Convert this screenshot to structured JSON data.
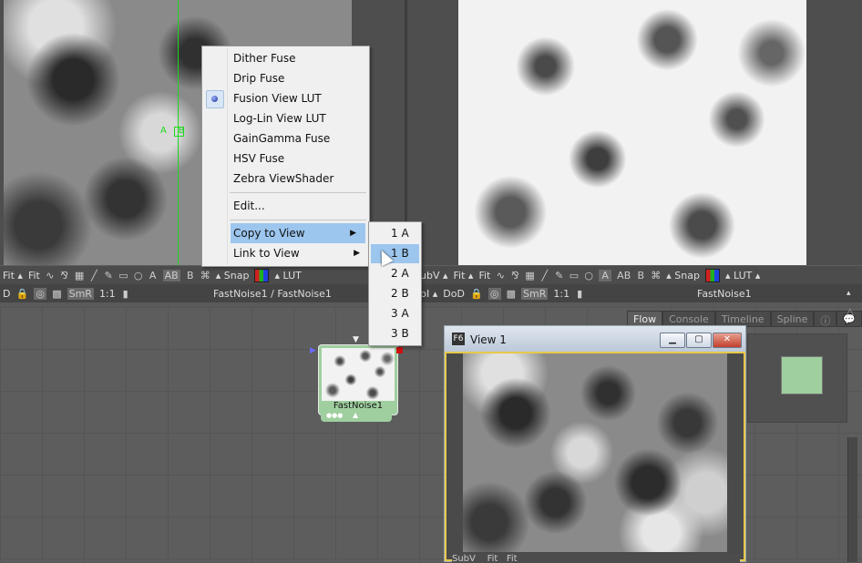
{
  "context_menu": {
    "items": [
      {
        "label": "Dither Fuse"
      },
      {
        "label": "Drip Fuse"
      },
      {
        "label": "Fusion View LUT",
        "selected": true
      },
      {
        "label": "Log-Lin View LUT"
      },
      {
        "label": "GainGamma Fuse"
      },
      {
        "label": "HSV Fuse"
      },
      {
        "label": "Zebra ViewShader"
      }
    ],
    "edit_label": "Edit...",
    "copy_to_view_label": "Copy to View",
    "link_to_view_label": "Link to View"
  },
  "submenu": {
    "items": [
      "1 A",
      "1 B",
      "2 A",
      "2 B",
      "3 A",
      "3 B"
    ],
    "highlighted": "1 B"
  },
  "left_viewer": {
    "guide_label": "A",
    "guide_label_b": "B",
    "toolbar": {
      "fit1": "Fit",
      "fit2": "Fit",
      "letter_a": "A",
      "letter_ab": "AB",
      "letter_b": "B",
      "snap": "Snap",
      "lut": "LUT",
      "d": "D",
      "smr": "SmR",
      "ratio": "1:1"
    },
    "view_name": "FastNoise1 / FastNoise1"
  },
  "right_viewer": {
    "toolbar": {
      "subv": "ubV",
      "fit1": "Fit",
      "fit2": "Fit",
      "letter_a": "A",
      "letter_ab": "AB",
      "letter_b": "B",
      "snap": "Snap",
      "lut": "LUT",
      "roi": "bI",
      "dod": "DoD",
      "smr": "SmR",
      "ratio": "1:1"
    },
    "view_name": "FastNoise1"
  },
  "panel_tabs": [
    "Flow",
    "Console",
    "Timeline",
    "Spline"
  ],
  "node": {
    "label": "FastNoise1"
  },
  "float_view": {
    "icon": "F6",
    "title": "View 1",
    "toolbar": {
      "subv": "SubV",
      "fit1": "Fit",
      "fit2": "Fit"
    }
  },
  "colors": {
    "node_fill": "#9fcf9f",
    "menu_highlight": "#9cc6ee",
    "guide": "#1fd81f"
  }
}
